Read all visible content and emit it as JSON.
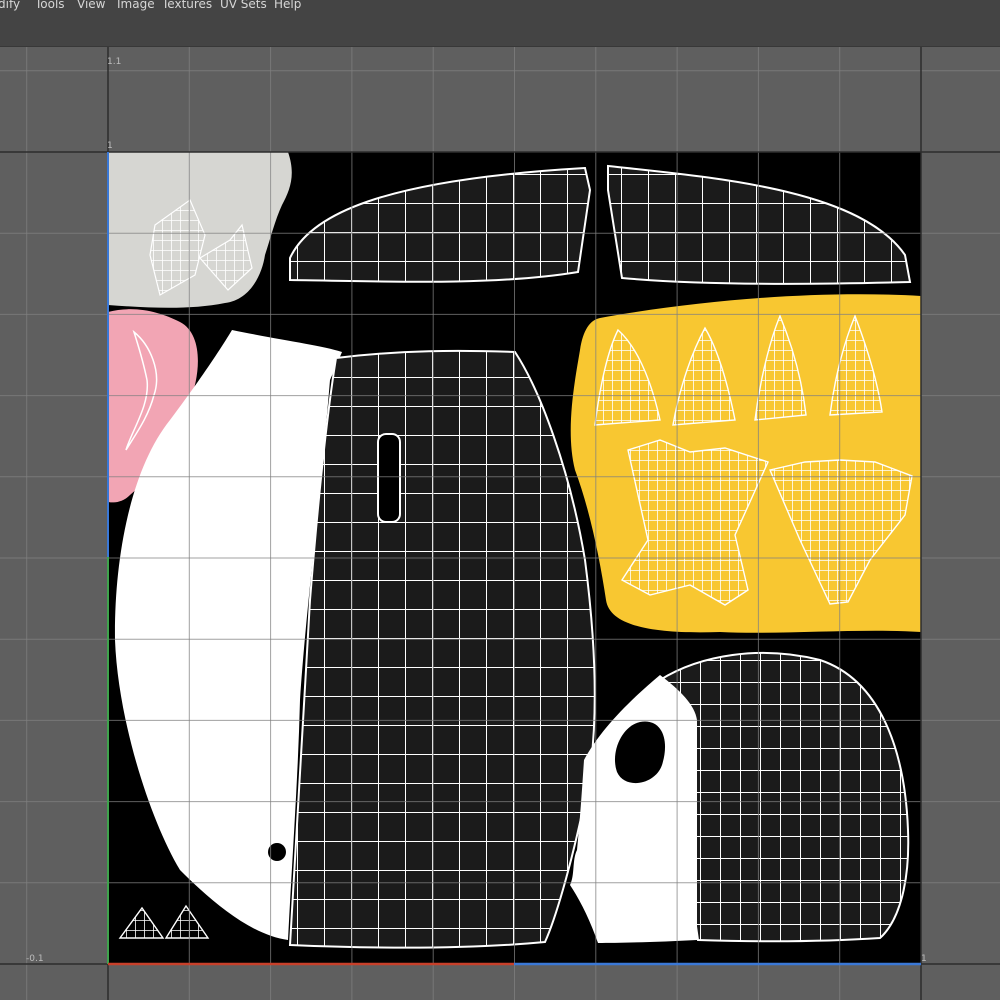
{
  "menu": {
    "items": [
      {
        "label": "dify"
      },
      {
        "label": "Tools"
      },
      {
        "label": "View"
      },
      {
        "label": "Image"
      },
      {
        "label": "Textures"
      },
      {
        "label": "UV Sets"
      },
      {
        "label": "Help"
      }
    ]
  },
  "uv_editor": {
    "labels": {
      "top_1_1": "1.1",
      "top_1": "1",
      "bottom_neg": "-0.1",
      "bottom_right_1": "1"
    },
    "colors": {
      "background": "#5f5f5f",
      "tile": "#000000",
      "grid_line": "#808080",
      "wireframe": "#ffffff",
      "island_white": "#ffffff",
      "island_dark": "#1b1b1b",
      "island_gray": "#d6d6d2",
      "island_pink": "#f2a5b4",
      "island_yellow": "#f8c731",
      "u_axis": "#c8402a",
      "v_axis": "#3a78d6"
    }
  }
}
